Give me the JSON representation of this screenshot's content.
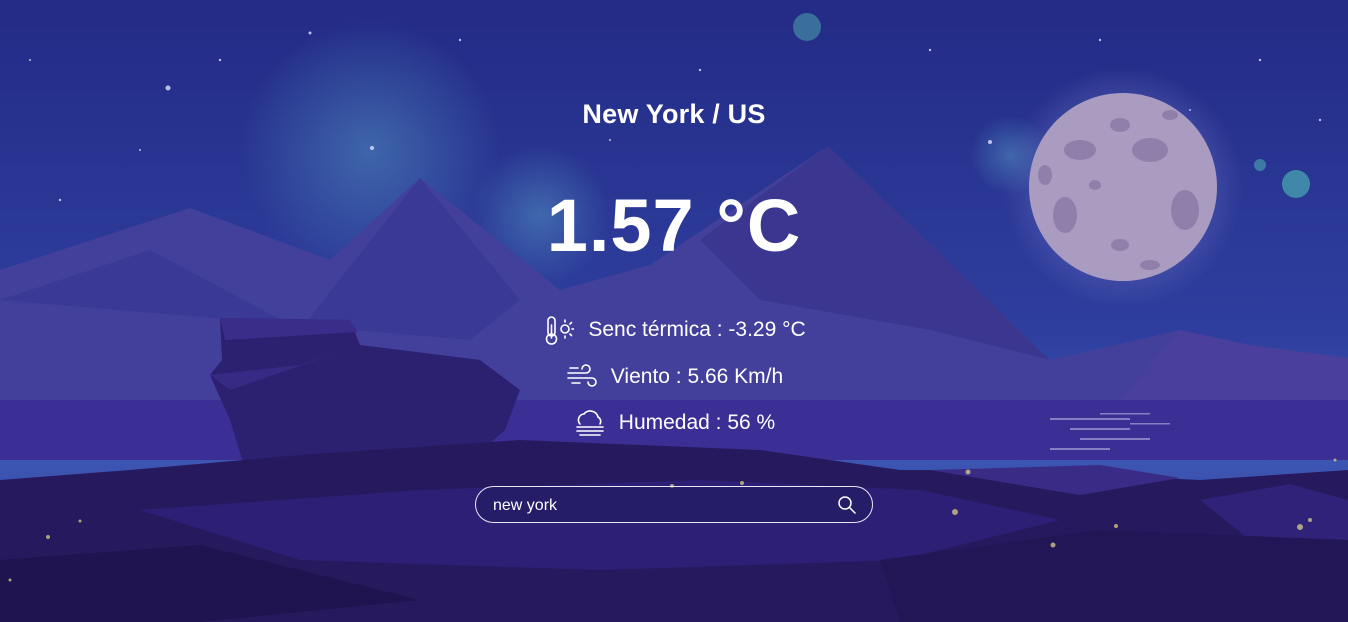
{
  "location": {
    "city": "New York / US"
  },
  "current": {
    "temperature": "1.57 °C"
  },
  "details": {
    "feels_like": "Senc térmica : -3.29 °C",
    "wind": "Viento : 5.66 Km/h",
    "humidity": "Humedad : 56 %"
  },
  "search": {
    "value": "new york",
    "placeholder": ""
  },
  "icons": {
    "feels_like": "thermometer-sun-icon",
    "wind": "wind-icon",
    "humidity": "fog-cloud-icon",
    "search": "search-icon"
  },
  "colors": {
    "sky_top": "#232b86",
    "sky_bottom": "#3c4fb0",
    "mountain": "#4a3f9e",
    "ground": "#2b1f66",
    "moon": "#a99cc0",
    "text": "#ffffff"
  }
}
